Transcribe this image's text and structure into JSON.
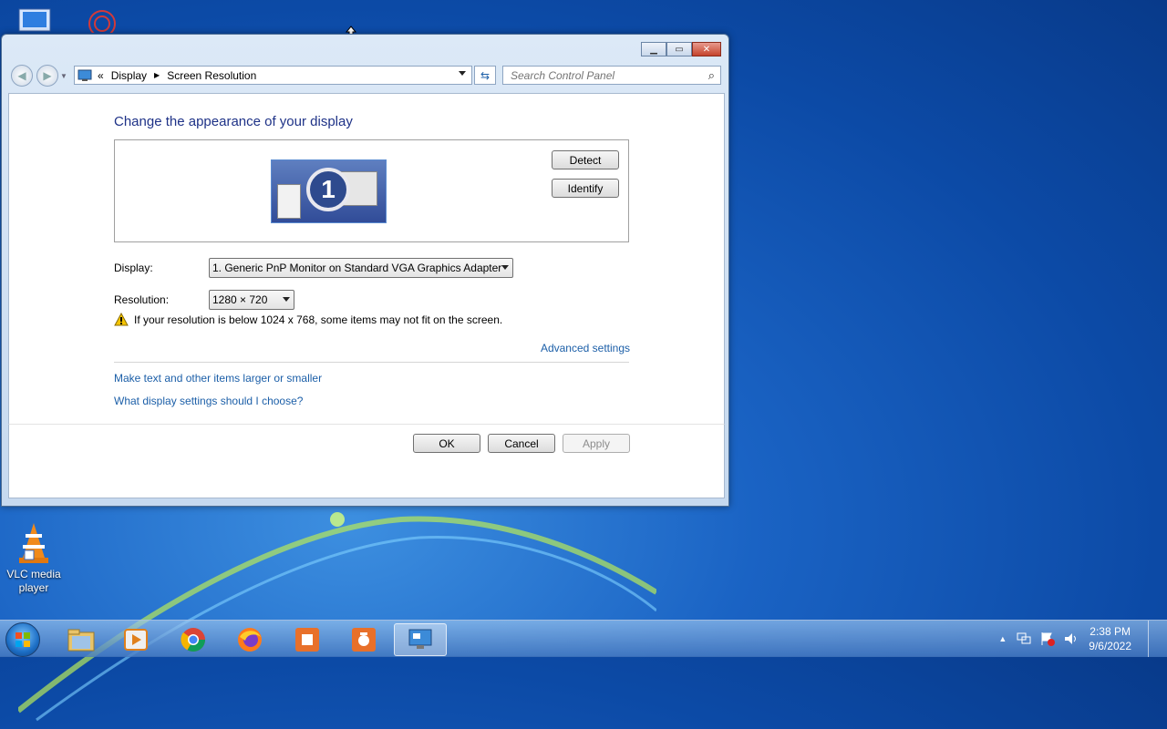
{
  "desktop": {
    "vlc_label": "VLC media player"
  },
  "window": {
    "address": {
      "segments": [
        "Display",
        "Screen Resolution"
      ],
      "overflow": "«"
    },
    "search": {
      "placeholder": "Search Control Panel"
    },
    "heading": "Change the appearance of your display",
    "monitor_number": "1",
    "detect_label": "Detect",
    "identify_label": "Identify",
    "display_label": "Display:",
    "display_value": "1. Generic PnP Monitor on Standard VGA Graphics Adapter",
    "resolution_label": "Resolution:",
    "resolution_value": "1280 × 720",
    "warning_text": "If your resolution is below 1024 x 768, some items may not fit on the screen.",
    "advanced_link": "Advanced settings",
    "links": [
      "Make text and other items larger or smaller",
      "What display settings should I choose?"
    ],
    "ok_label": "OK",
    "cancel_label": "Cancel",
    "apply_label": "Apply"
  },
  "taskbar": {
    "items": [
      "explorer",
      "media-player",
      "chrome",
      "firefox",
      "screenshot-app",
      "camera-app",
      "display-settings"
    ],
    "clock_time": "2:38 PM",
    "clock_date": "9/6/2022"
  },
  "colors": {
    "link": "#1c5fa8",
    "heading": "#1e3287",
    "desktop": "#0c4aa6"
  }
}
